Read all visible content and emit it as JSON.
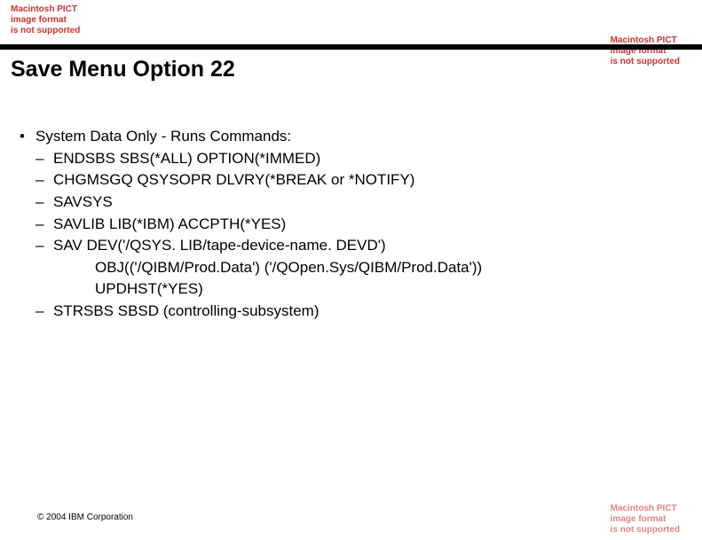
{
  "pict_warning": {
    "line1": "Macintosh PICT",
    "line2": "image format",
    "line3": "is not supported"
  },
  "title": "Save Menu Option 22",
  "main": {
    "bullet_text": "System Data Only - Runs Commands:",
    "items": [
      {
        "text": "ENDSBS SBS(*ALL) OPTION(*IMMED)"
      },
      {
        "text": "CHGMSGQ QSYSOPR DLVRY(*BREAK or *NOTIFY)"
      },
      {
        "text": "SAVSYS"
      },
      {
        "text": "SAVLIB LIB(*IBM) ACCPTH(*YES)"
      },
      {
        "text": "SAV DEV('/QSYS. LIB/tape-device-name. DEVD')",
        "cont": [
          "OBJ(('/QIBM/Prod.Data') ('/QOpen.Sys/QIBM/Prod.Data'))",
          "UPDHST(*YES)"
        ]
      },
      {
        "text": "STRSBS SBSD (controlling-subsystem)"
      }
    ]
  },
  "footer": "© 2004 IBM Corporation"
}
